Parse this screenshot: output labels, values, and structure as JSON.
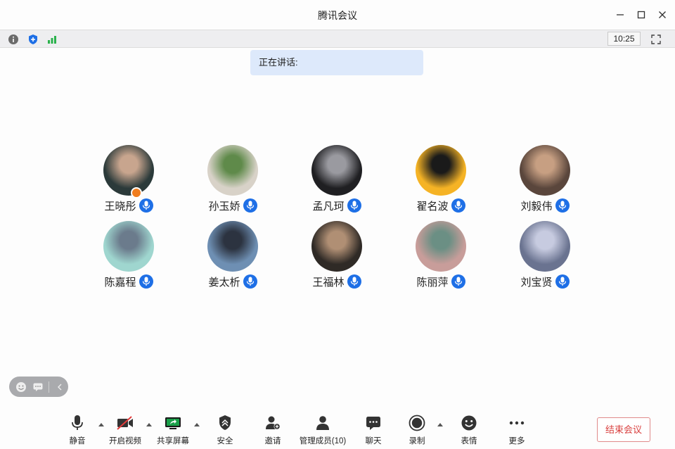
{
  "window": {
    "title": "腾讯会议"
  },
  "statusbar": {
    "time": "10:25",
    "icons": [
      "info-icon",
      "shield-icon",
      "signal-bars-icon",
      "fullscreen-icon"
    ]
  },
  "speaking": {
    "label": "正在讲话:"
  },
  "participants": [
    {
      "name": "王晓彤",
      "host": true,
      "avatar_colors": [
        "#2b3a3a",
        "#c8a58e"
      ]
    },
    {
      "name": "孙玉娇",
      "host": false,
      "avatar_colors": [
        "#d8d2c8",
        "#5f8a4a"
      ]
    },
    {
      "name": "孟凡珂",
      "host": false,
      "avatar_colors": [
        "#1f1f22",
        "#9a9aa0"
      ]
    },
    {
      "name": "翟名波",
      "host": false,
      "avatar_colors": [
        "#f5b325",
        "#1a1a1a"
      ]
    },
    {
      "name": "刘毅伟",
      "host": false,
      "avatar_colors": [
        "#5a463c",
        "#c79f82"
      ]
    },
    {
      "name": "陈嘉程",
      "host": false,
      "avatar_colors": [
        "#9fd6cf",
        "#6b7b8c"
      ]
    },
    {
      "name": "姜太析",
      "host": false,
      "avatar_colors": [
        "#6e8fb3",
        "#2c3340"
      ]
    },
    {
      "name": "王福林",
      "host": false,
      "avatar_colors": [
        "#2f2a26",
        "#b08f74"
      ]
    },
    {
      "name": "陈丽萍",
      "host": false,
      "avatar_colors": [
        "#c89d9a",
        "#6b8f84"
      ]
    },
    {
      "name": "刘宝贤",
      "host": false,
      "avatar_colors": [
        "#6a7390",
        "#c7cbe0"
      ]
    }
  ],
  "toolbar": {
    "mute": "静音",
    "video": "开启视频",
    "share": "共享屏幕",
    "security": "安全",
    "invite": "邀请",
    "members": "管理成员(10)",
    "chat": "聊天",
    "record": "录制",
    "reactions": "表情",
    "more": "更多",
    "end": "结束会议"
  },
  "colors": {
    "accent": "#1e6fe6",
    "host_badge": "#f07d1e",
    "end_text": "#d9403f",
    "speaking_bg": "#dde9fb"
  }
}
